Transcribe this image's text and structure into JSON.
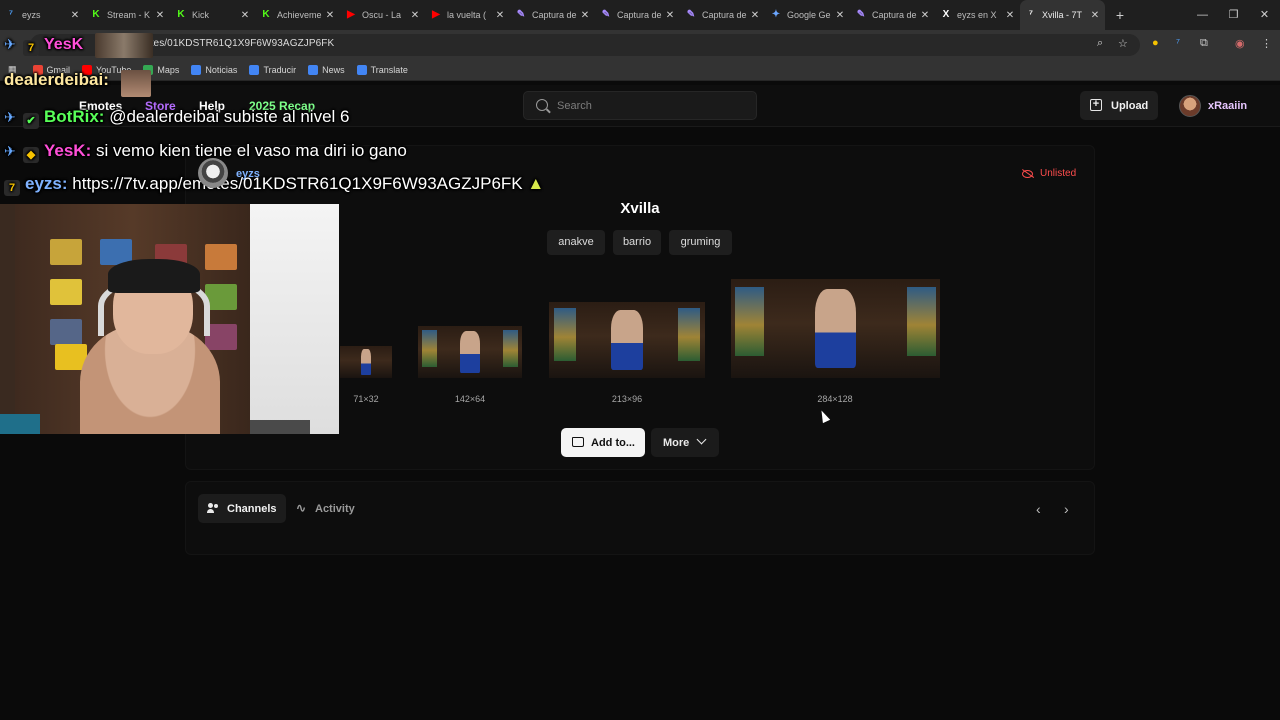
{
  "browser": {
    "tabs": [
      {
        "icon": "7tv-icon",
        "label": "eyzs",
        "active": false,
        "color": "#4fa3ff"
      },
      {
        "icon": "kick-icon",
        "label": "Stream - K",
        "active": false,
        "color": "#53fc18"
      },
      {
        "icon": "kick-icon",
        "label": "Kick",
        "active": false,
        "color": "#53fc18"
      },
      {
        "icon": "kick-icon",
        "label": "Achieveme",
        "active": false,
        "color": "#53fc18"
      },
      {
        "icon": "youtube-icon",
        "label": "Oscu - La",
        "active": false,
        "color": "#ff0000"
      },
      {
        "icon": "youtube-icon",
        "label": "la vuelta (",
        "active": false,
        "color": "#ff0000"
      },
      {
        "icon": "pen-icon",
        "label": "Captura de",
        "active": false,
        "color": "#a98bff"
      },
      {
        "icon": "pen-icon",
        "label": "Captura de",
        "active": false,
        "color": "#a98bff"
      },
      {
        "icon": "pen-icon",
        "label": "Captura de",
        "active": false,
        "color": "#a98bff"
      },
      {
        "icon": "gemini-icon",
        "label": "Google Ge",
        "active": false,
        "color": "#6ba6ff"
      },
      {
        "icon": "pen-icon",
        "label": "Captura de",
        "active": false,
        "color": "#a98bff"
      },
      {
        "icon": "x-icon",
        "label": "eyzs en X",
        "active": false,
        "color": "#ffffff"
      },
      {
        "icon": "7tv-icon",
        "label": "Xvilla - 7T",
        "active": true,
        "color": "#ffffff"
      }
    ],
    "new_tab": "+",
    "url": "otes/01KDSTR61Q1X9F6W93AGZJP6FK",
    "bookmarks": [
      {
        "label": "Gmail",
        "icon": "gmail-icon",
        "color": "#ea4335"
      },
      {
        "label": "YouTube",
        "icon": "youtube-icon",
        "color": "#ff0000"
      },
      {
        "label": "Maps",
        "icon": "maps-icon",
        "color": "#34a853"
      },
      {
        "label": "Noticias",
        "icon": "news-icon",
        "color": "#4285f4"
      },
      {
        "label": "Traducir",
        "icon": "translate-icon",
        "color": "#4285f4"
      },
      {
        "label": "News",
        "icon": "news-icon",
        "color": "#4285f4"
      },
      {
        "label": "Translate",
        "icon": "translate-icon",
        "color": "#4285f4"
      }
    ]
  },
  "site": {
    "nav": [
      {
        "label": "Emotes",
        "color": "#ffffff"
      },
      {
        "label": "Store",
        "color": "#b56cff"
      },
      {
        "label": "Help",
        "color": "#ffffff"
      },
      {
        "label": "2025 Recap",
        "color": "#7dff8a"
      }
    ],
    "search_placeholder": "Search",
    "upload_label": "Upload",
    "username": "xRaaiin"
  },
  "emote": {
    "name": "Xvilla",
    "status": "Unlisted",
    "tags": [
      "anakve",
      "barrio",
      "gruming"
    ],
    "sizes": [
      "71×32",
      "142×64",
      "213×96",
      "284×128"
    ],
    "add_label": "Add to...",
    "more_label": "More"
  },
  "panel": {
    "tabs": [
      {
        "label": "Channels",
        "active": true
      },
      {
        "label": "Activity",
        "active": false
      }
    ]
  },
  "overlay": {
    "chat": [
      {
        "user": "YesK",
        "user_color": "#ff4fd8",
        "message": ""
      },
      {
        "user": "dealerdeibai:",
        "user_color": "#ffe8a0",
        "message": ""
      },
      {
        "user": "BotRix:",
        "user_color": "#58ff58",
        "message": "@dealerdeibai subiste al nivel 6"
      },
      {
        "user": "YesK:",
        "user_color": "#ff4fd8",
        "message": "si vemo kien tiene el vaso ma diri io gano"
      },
      {
        "user": "eyzs:",
        "user_color": "#7fb2ff",
        "message": "https://7tv.app/emotes/01KDSTR61Q1X9F6W93AGZJP6FK"
      }
    ],
    "tag_name": "eyzs"
  }
}
